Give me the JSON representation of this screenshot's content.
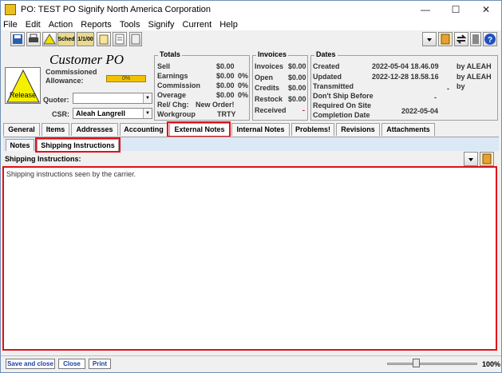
{
  "window": {
    "title": "PO: TEST PO   Signify North America Corporation",
    "controls": [
      "—",
      "☐",
      "✕"
    ]
  },
  "menu": [
    "File",
    "Edit",
    "Action",
    "Reports",
    "Tools",
    "Signify",
    "Current",
    "Help"
  ],
  "toolbar": {
    "sched_label": "Sched",
    "date_label": "1/1/00"
  },
  "header": {
    "title": "Customer PO",
    "commissioned_label": "Commissioned",
    "allowance_label": "Allowance:",
    "allowance_value": "0%",
    "release_label": "Release",
    "quoter_label": "Quoter:",
    "quoter_value": "",
    "csr_label": "CSR:",
    "csr_value": "Aleah Langrell"
  },
  "totals": {
    "title": "Totals",
    "rows": [
      {
        "label": "Sell",
        "value": "$0.00",
        "pct": ""
      },
      {
        "label": "Earnings",
        "value": "$0.00",
        "pct": "0%"
      },
      {
        "label": "Commission",
        "value": "$0.00",
        "pct": "0%"
      },
      {
        "label": "Overage",
        "value": "$0.00",
        "pct": "0%"
      },
      {
        "label": "Rel/ Chg:",
        "value": "New Order!",
        "pct": ""
      },
      {
        "label": "Workgroup",
        "value": "TRTY",
        "pct": ""
      }
    ]
  },
  "invoices": {
    "title": "Invoices",
    "rows": [
      {
        "label": "Invoices",
        "value": "$0.00"
      },
      {
        "label": "Open",
        "value": "$0.00"
      },
      {
        "label": "Credits",
        "value": "$0.00"
      },
      {
        "label": "Restock",
        "value": "$0.00"
      },
      {
        "label": "Received",
        "value": "-"
      }
    ]
  },
  "dates": {
    "title": "Dates",
    "rows": [
      {
        "label": "Created",
        "value": "2022-05-04 18.46.09",
        "by": "by ALEAH"
      },
      {
        "label": "Updated",
        "value": "2022-12-28 18.58.16",
        "by": "by ALEAH"
      },
      {
        "label": "Transmitted",
        "value": "-",
        "by": "by"
      },
      {
        "label": "Don't Ship Before",
        "value": "-",
        "by": ""
      },
      {
        "label": "Required On Site",
        "value": "",
        "by": ""
      },
      {
        "label": "Completion Date",
        "value": "2022-05-04",
        "by": ""
      }
    ]
  },
  "tabs": [
    "General",
    "Items",
    "Addresses",
    "Accounting",
    "External Notes",
    "Internal Notes",
    "Problems!",
    "Revisions",
    "Attachments"
  ],
  "subtabs": [
    "Notes",
    "Shipping Instructions"
  ],
  "shipping": {
    "label": "Shipping Instructions:",
    "text": "Shipping instructions seen by the carrier."
  },
  "footer": {
    "save_close": "Save and close",
    "close": "Close",
    "print": "Print",
    "zoom": "100%"
  }
}
